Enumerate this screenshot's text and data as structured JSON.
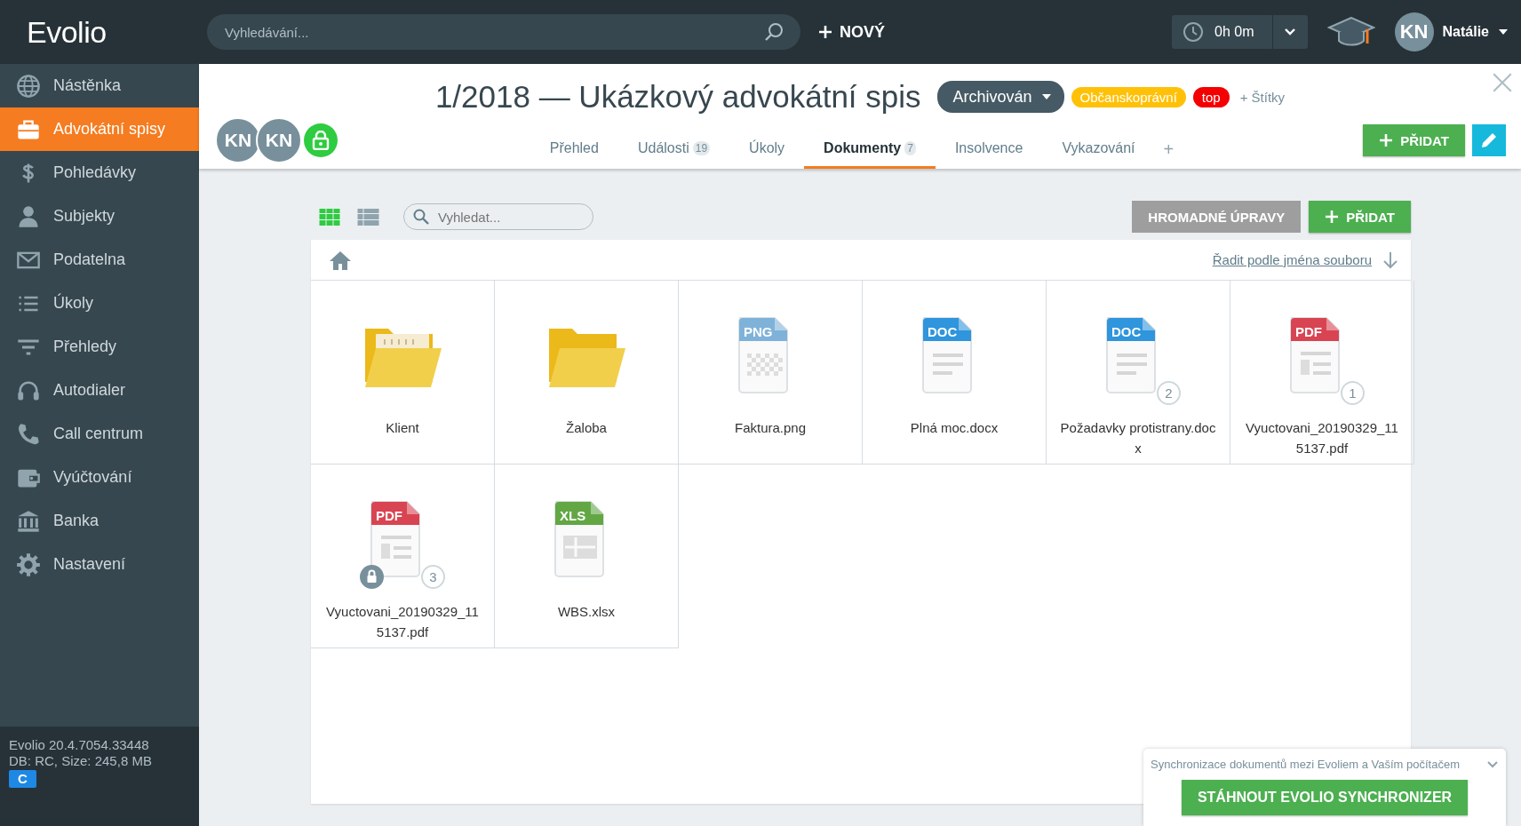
{
  "app": {
    "logo": "Evolio",
    "search_placeholder": "Vyhledávání...",
    "new_button": "NOVÝ",
    "timer": "0h 0m",
    "user": {
      "initials": "KN",
      "name": "Natálie"
    }
  },
  "sidebar": {
    "items": [
      {
        "label": "Nástěnka",
        "selected": false
      },
      {
        "label": "Advokátní spisy",
        "selected": true
      },
      {
        "label": "Pohledávky",
        "selected": false
      },
      {
        "label": "Subjekty",
        "selected": false
      },
      {
        "label": "Podatelna",
        "selected": false
      },
      {
        "label": "Úkoly",
        "selected": false
      },
      {
        "label": "Přehledy",
        "selected": false
      },
      {
        "label": "Autodialer",
        "selected": false
      },
      {
        "label": "Call centrum",
        "selected": false
      },
      {
        "label": "Vyúčtování",
        "selected": false
      },
      {
        "label": "Banka",
        "selected": false
      },
      {
        "label": "Nastavení",
        "selected": false
      }
    ],
    "version": "Evolio 20.4.7054.33448",
    "db_info": "DB: RC, Size: 245,8 MB",
    "badge": "C"
  },
  "case": {
    "title": "1/2018 — Ukázkový advokátní spis",
    "status": "Archivován",
    "tags": [
      {
        "label": "Občanskoprávní",
        "color": "#ffc107"
      },
      {
        "label": "top",
        "color": "#f50000"
      }
    ],
    "add_tags": "+ Štítky",
    "members": [
      "KN",
      "KN"
    ],
    "tabs": [
      {
        "label": "Přehled",
        "selected": false
      },
      {
        "label": "Události",
        "count": "19",
        "selected": false
      },
      {
        "label": "Úkoly",
        "selected": false
      },
      {
        "label": "Dokumenty",
        "count": "7",
        "selected": true
      },
      {
        "label": "Insolvence",
        "selected": false
      },
      {
        "label": "Vykazování",
        "selected": false
      }
    ],
    "add_tab": "+",
    "add_button": "PŘIDAT"
  },
  "documents": {
    "view_modes": [
      {
        "kind": "grid",
        "selected": true
      },
      {
        "kind": "list",
        "selected": false
      }
    ],
    "search_placeholder": "Vyhledat...",
    "bulk_edit_button": "HROMADNÉ ÚPRAVY",
    "add_button": "PŘIDAT",
    "sort_link": "Řadit podle jména souboru",
    "items": [
      {
        "kind": "folder",
        "name": "Klient",
        "has_content": true,
        "locked": false
      },
      {
        "kind": "folder",
        "name": "Žaloba",
        "has_content": false,
        "locked": false
      },
      {
        "kind": "image",
        "name": "Faktura.png",
        "type_label": "PNG",
        "color": "#7fb2d9",
        "locked": false
      },
      {
        "kind": "document",
        "name": "Plná moc.docx",
        "type_label": "DOC",
        "color": "#2f95dc",
        "locked": false
      },
      {
        "kind": "document",
        "name": "Požadavky protistrany.docx",
        "type_label": "DOC",
        "color": "#2f95dc",
        "version": "2",
        "locked": false
      },
      {
        "kind": "pdf",
        "name": "Vyuctovani_20190329_115137.pdf",
        "type_label": "PDF",
        "color": "#d94452",
        "version": "1",
        "locked": false
      },
      {
        "kind": "pdf",
        "name": "Vyuctovani_20190329_115137.pdf",
        "type_label": "PDF",
        "color": "#d94452",
        "version": "3",
        "locked": true
      },
      {
        "kind": "spreadsheet",
        "name": "WBS.xlsx",
        "type_label": "XLS",
        "color": "#62a744",
        "locked": false
      }
    ]
  },
  "sync_panel": {
    "text": "Synchronizace dokumentů mezi Evoliem a Vaším počítačem",
    "button": "STÁHNOUT EVOLIO SYNCHRONIZER"
  }
}
